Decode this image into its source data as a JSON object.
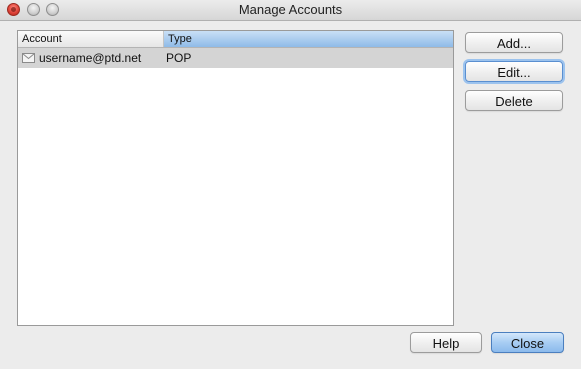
{
  "window": {
    "title": "Manage Accounts"
  },
  "list": {
    "columns": [
      "Account",
      "Type"
    ],
    "rows": [
      {
        "icon": "envelope-icon",
        "account": "username@ptd.net",
        "type": "POP"
      }
    ]
  },
  "buttons": {
    "add": "Add...",
    "edit": "Edit...",
    "delete": "Delete",
    "help": "Help",
    "close": "Close"
  },
  "colors": {
    "selected_header": "#8fbbe8",
    "selected_row": "#d4d4d4",
    "default_button": "#a8cdf3"
  }
}
